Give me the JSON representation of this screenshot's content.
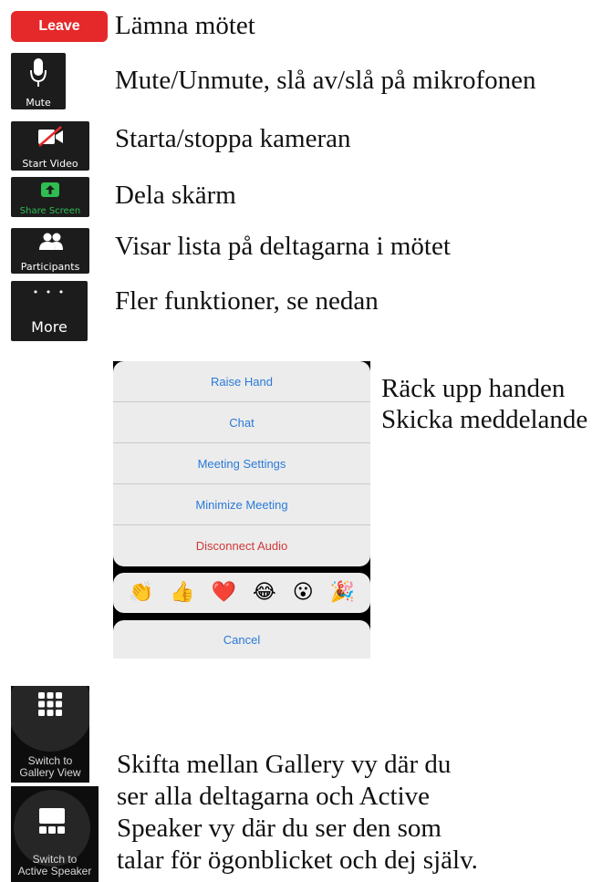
{
  "toolbar": {
    "leave": {
      "button": "Leave",
      "description": "Lämna mötet"
    },
    "mute": {
      "label": "Mute",
      "description": "Mute/Unmute, slå av/slå på mikrofonen"
    },
    "video": {
      "label": "Start Video",
      "description": "Starta/stoppa kameran"
    },
    "share": {
      "label": "Share Screen",
      "description": "Dela skärm"
    },
    "participants": {
      "label": "Participants",
      "description": "Visar lista på deltagarna i mötet"
    },
    "more": {
      "label": "More",
      "dots": "• • •",
      "description": "Fler funktioner, se nedan"
    }
  },
  "more_menu": {
    "items": [
      {
        "label": "Raise Hand"
      },
      {
        "label": "Chat"
      },
      {
        "label": "Meeting Settings"
      },
      {
        "label": "Minimize Meeting"
      },
      {
        "label": "Disconnect Audio",
        "style": "destructive"
      }
    ],
    "reactions": [
      "👏",
      "👍",
      "❤️",
      "😂",
      "😮",
      "🎉"
    ],
    "cancel": "Cancel",
    "notes": [
      "Räck upp handen",
      "Skicka meddelande"
    ]
  },
  "views": {
    "gallery": {
      "label_line1": "Switch to",
      "label_line2": "Gallery View"
    },
    "speaker": {
      "label_line1": "Switch to",
      "label_line2": "Active Speaker"
    },
    "description_lines": [
      "Skifta mellan Gallery vy där du",
      "ser alla deltagarna och Active",
      "Speaker vy där du ser den som",
      "talar för ögonblicket och dej själv."
    ]
  },
  "colors": {
    "leave_red": "#e5292a",
    "share_green": "#2fbd52",
    "link_blue": "#2a7ad8",
    "destructive_red": "#d0383a",
    "tile_bg": "#1c1c1c"
  }
}
